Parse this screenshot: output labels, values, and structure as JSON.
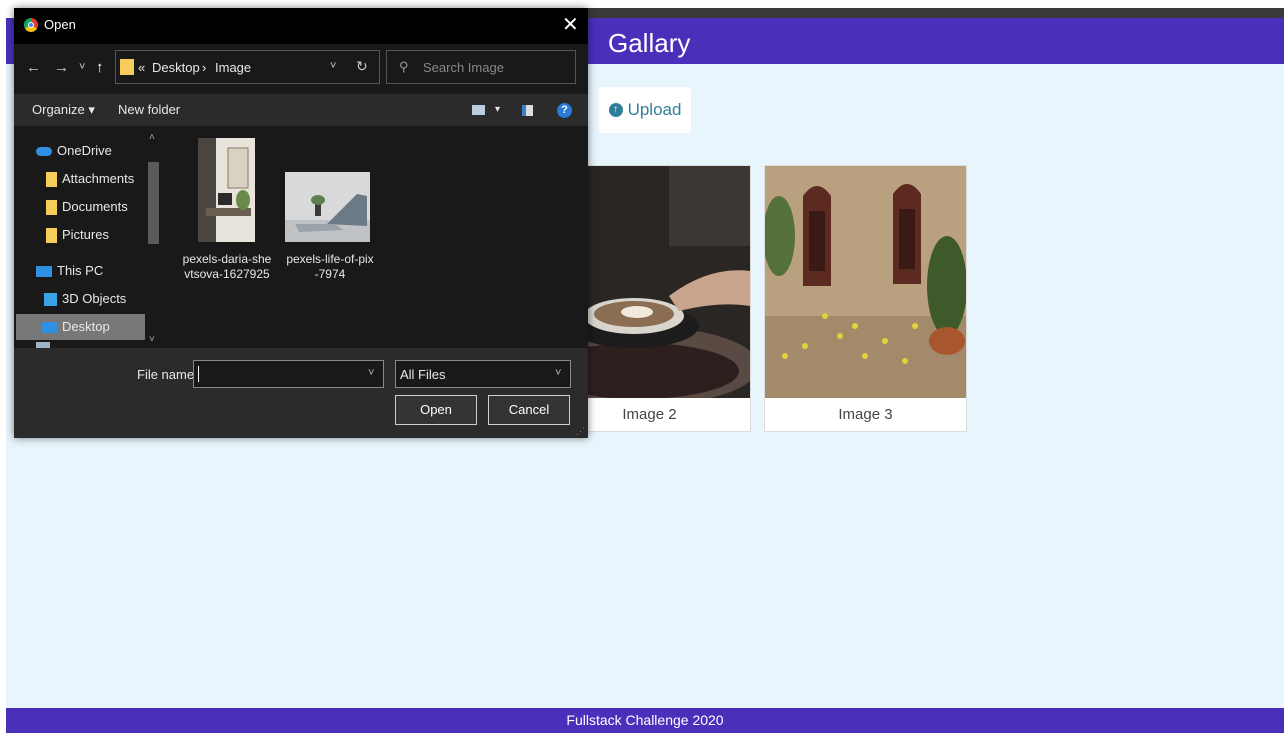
{
  "app": {
    "brand": "Gallary",
    "upload_label": "Upload",
    "cards": [
      {
        "caption": "Image 2"
      },
      {
        "caption": "Image 3"
      }
    ],
    "footer": "Fullstack Challenge 2020",
    "colors": {
      "navbar": "#4a2fbb",
      "page_bg": "#e9f5fc",
      "accent": "#2f7f9a"
    }
  },
  "dialog": {
    "title": "Open",
    "close_glyph": "✕",
    "nav": {
      "back": "←",
      "forward": "→",
      "recent": "˅",
      "up": "↑"
    },
    "address": {
      "overflow": "«",
      "path": [
        "Desktop",
        "Image"
      ],
      "separator": "›",
      "dropdown": "˅",
      "refresh": "↻"
    },
    "search_placeholder": "Search Image",
    "toolbar": {
      "organize": "Organize ▾",
      "new_folder": "New folder",
      "view_dropdown": "▾",
      "help": "?"
    },
    "nav_pane": [
      {
        "label": "OneDrive",
        "icon": "cloud-icon"
      },
      {
        "label": "Attachments",
        "icon": "folder-icon"
      },
      {
        "label": "Documents",
        "icon": "folder-icon"
      },
      {
        "label": "Pictures",
        "icon": "folder-icon"
      },
      {
        "label": "This PC",
        "icon": "computer-icon"
      },
      {
        "label": "3D Objects",
        "icon": "cube-icon"
      },
      {
        "label": "Desktop",
        "icon": "desktop-icon",
        "selected": true
      }
    ],
    "files": [
      {
        "line1": "pexels-daria-she",
        "line2": "vtsova-1627925"
      },
      {
        "line1": "pexels-life-of-pix",
        "line2": "-7974"
      }
    ],
    "file_name_label": "File name:",
    "file_name_value": "",
    "filter_value": "All Files",
    "open_label": "Open",
    "cancel_label": "Cancel"
  }
}
